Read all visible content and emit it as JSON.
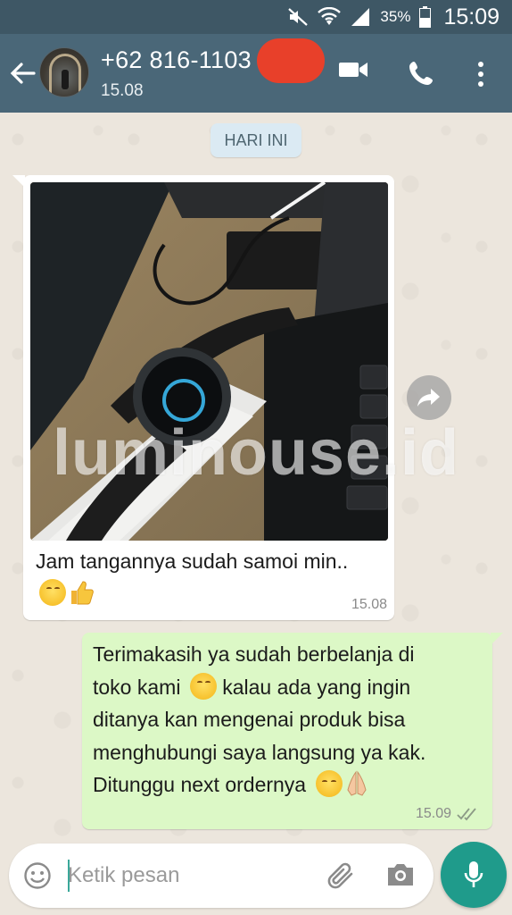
{
  "status_bar": {
    "battery_percent": "35%",
    "time": "15:09",
    "icons": [
      "mute-icon",
      "wifi-icon",
      "signal-icon",
      "battery-icon"
    ]
  },
  "header": {
    "contact_number": "+62 816-1103",
    "subtitle": "15.08",
    "icons": [
      "back-arrow-icon",
      "video-call-icon",
      "phone-call-icon",
      "more-vert-icon"
    ]
  },
  "date_chip": "HARI INI",
  "messages": [
    {
      "direction": "incoming",
      "has_photo": true,
      "text": "Jam tangannya sudah samoi min..",
      "emojis": [
        "smiling-face-emoji",
        "thumbs-up-emoji"
      ],
      "time": "15.08"
    },
    {
      "direction": "outgoing",
      "lines": [
        "Terimakasih ya sudah berbelanja di",
        "toko kami",
        "kalau ada yang ingin",
        "ditanya kan mengenai produk bisa",
        "menghubungi saya langsung ya kak.",
        "Ditunggu next ordernya"
      ],
      "emojis": [
        "smiling-face-emoji",
        "relieved-face-emoji",
        "folded-hands-emoji"
      ],
      "time": "15.09",
      "status": "double-check-icon"
    }
  ],
  "watermark": "luminouse.id",
  "input": {
    "placeholder": "Ketik pesan",
    "icons": [
      "emoji-icon",
      "attach-icon",
      "camera-icon",
      "mic-icon"
    ]
  },
  "colors": {
    "status_bar": "#3e5765",
    "header": "#4a6778",
    "outgoing_bubble": "#dcf8c6",
    "mic_button": "#1f9b8b"
  }
}
